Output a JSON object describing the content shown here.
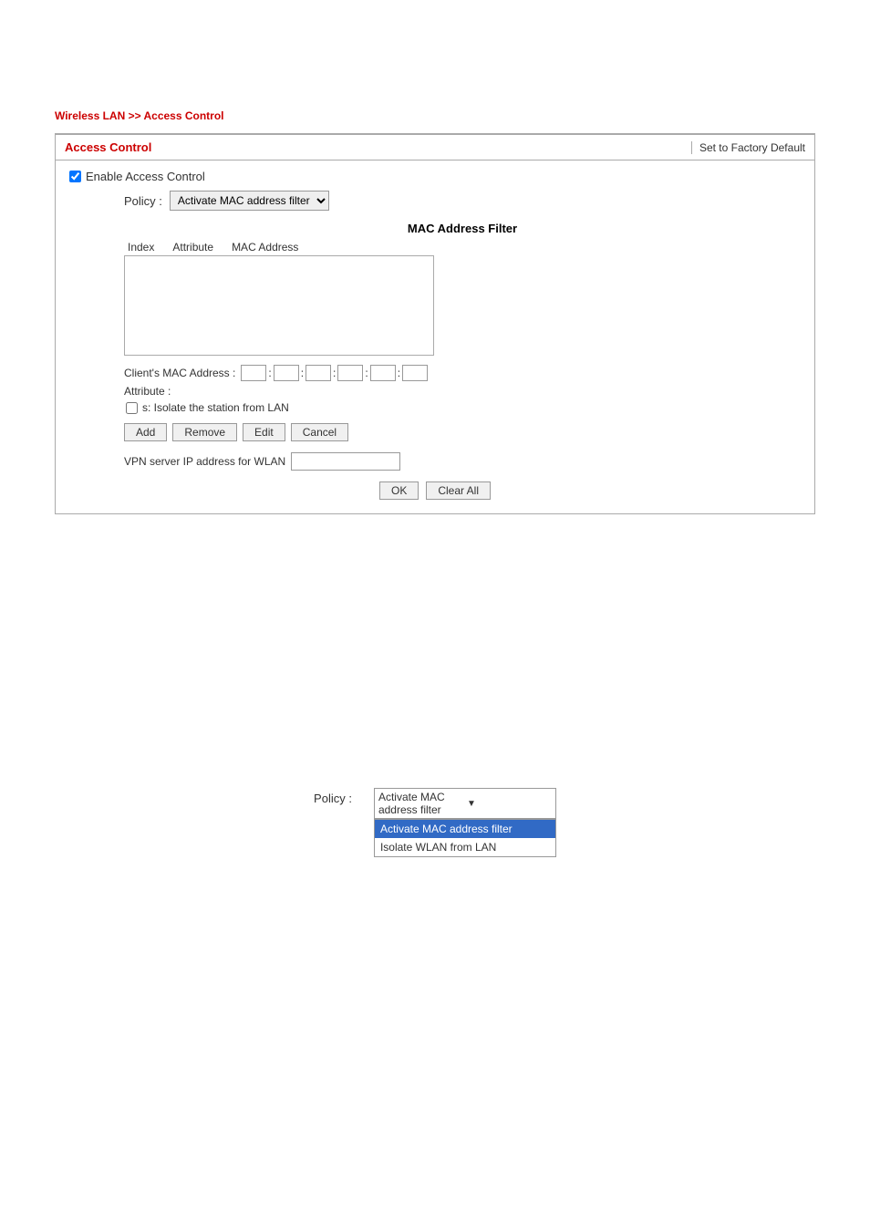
{
  "breadcrumb": {
    "text": "Wireless LAN >> Access Control"
  },
  "panel": {
    "title": "Access Control",
    "set_factory_default": "Set to Factory Default",
    "enable_label": "Enable Access Control",
    "policy_label": "Policy :",
    "policy_value": "Activate MAC address filter",
    "mac_filter": {
      "title": "MAC Address Filter",
      "columns": [
        "Index",
        "Attribute",
        "MAC Address"
      ]
    },
    "client_mac_label": "Client's MAC Address :",
    "attribute_label": "Attribute :",
    "attribute_checkbox_label": "s: Isolate the station from LAN",
    "buttons": {
      "add": "Add",
      "remove": "Remove",
      "edit": "Edit",
      "cancel": "Cancel"
    },
    "vpn_label": "VPN server IP address for WLAN",
    "ok_button": "OK",
    "clear_all_button": "Clear All"
  },
  "dropdown_demo": {
    "policy_label": "Policy :",
    "selected_option": "Activate MAC address filter",
    "options": [
      "Activate MAC address filter",
      "Isolate WLAN from LAN"
    ]
  }
}
